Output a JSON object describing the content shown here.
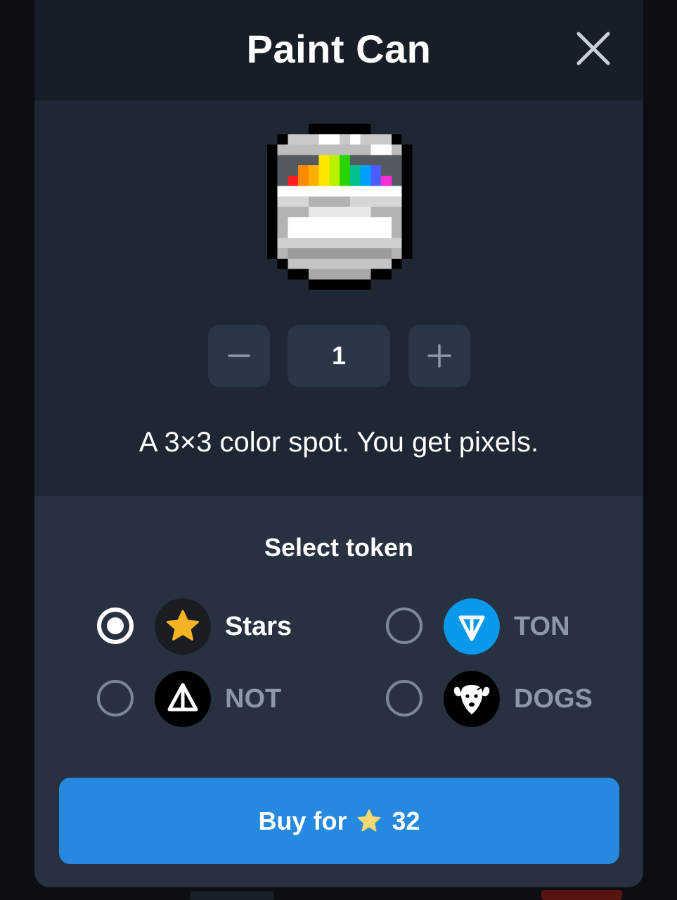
{
  "modal": {
    "title": "Paint Can"
  },
  "item": {
    "icon": "paint-can-icon",
    "quantity": "1",
    "description": "A 3×3 color spot. You get pixels."
  },
  "token_selector": {
    "heading": "Select token",
    "selected": "Stars",
    "options": [
      {
        "label": "Stars",
        "icon": "star-icon",
        "selected": true
      },
      {
        "label": "TON",
        "icon": "ton-icon",
        "selected": false
      },
      {
        "label": "NOT",
        "icon": "not-icon",
        "selected": false
      },
      {
        "label": "DOGS",
        "icon": "dogs-icon",
        "selected": false
      }
    ]
  },
  "buy_button": {
    "prefix": "Buy for",
    "amount": "32",
    "currency_icon": "star-icon"
  },
  "colors": {
    "accent": "#2589e0",
    "ton_blue": "#0a98ea",
    "star_gold": "#f5b324"
  }
}
